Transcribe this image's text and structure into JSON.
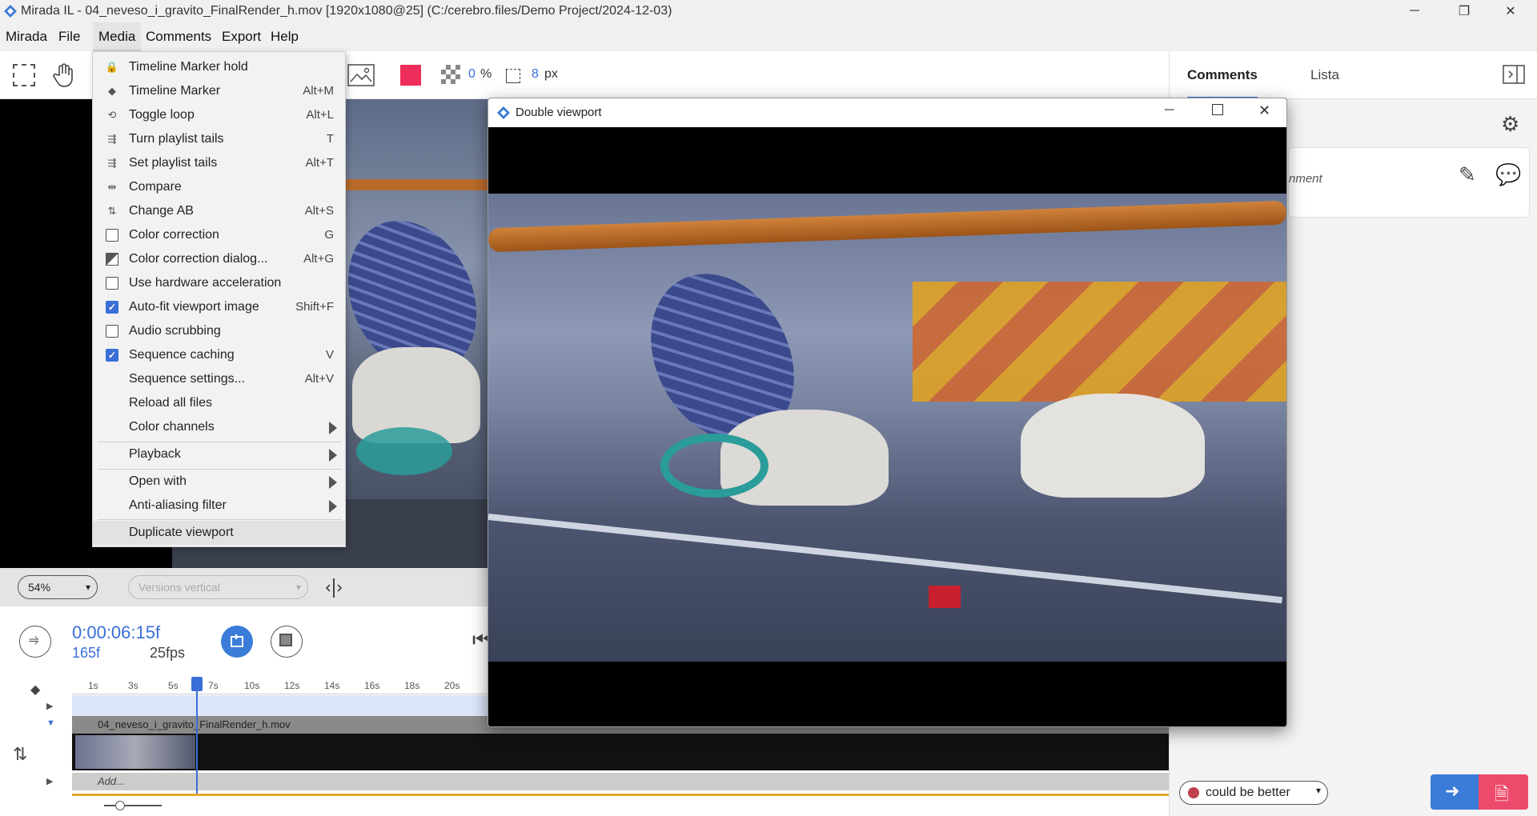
{
  "window": {
    "title": "Mirada IL - 04_neveso_i_gravito_FinalRender_h.mov [1920x1080@25] (C:/cerebro.files/Demo Project/2024-12-03)",
    "minimize": "─",
    "restore": "❐",
    "close": "✕"
  },
  "menubar": [
    "Mirada",
    "File",
    "Media",
    "Comments",
    "Export",
    "Help"
  ],
  "toolbar": {
    "opacity_value": "0",
    "opacity_unit": "%",
    "brush_size": "8",
    "brush_unit": "px",
    "color": "#ee2e5a"
  },
  "media_menu": {
    "items": [
      {
        "label": "Timeline Marker hold",
        "shortcut": "",
        "icon": "lock-icon"
      },
      {
        "label": "Timeline Marker",
        "shortcut": "Alt+M",
        "icon": "diamond-icon"
      },
      {
        "label": "Toggle loop",
        "shortcut": "Alt+L",
        "icon": "loop-icon"
      },
      {
        "label": "Turn playlist tails",
        "shortcut": "T",
        "icon": "tails-icon"
      },
      {
        "label": "Set playlist tails",
        "shortcut": "Alt+T",
        "icon": "tails-icon"
      },
      {
        "label": "Compare",
        "shortcut": "",
        "icon": "compare-icon"
      },
      {
        "label": "Change AB",
        "shortcut": "Alt+S",
        "icon": "swap-icon"
      },
      {
        "label": "Color correction",
        "shortcut": "G",
        "icon": "checkbox"
      },
      {
        "label": "Color correction dialog...",
        "shortcut": "Alt+G",
        "icon": "color-dialog-icon"
      },
      {
        "label": "Use hardware acceleration",
        "shortcut": "",
        "icon": "checkbox"
      },
      {
        "label": "Auto-fit viewport image",
        "shortcut": "Shift+F",
        "icon": "checkbox-checked"
      },
      {
        "label": "Audio scrubbing",
        "shortcut": "",
        "icon": "checkbox"
      },
      {
        "label": "Sequence caching",
        "shortcut": "V",
        "icon": "checkbox-checked"
      },
      {
        "label": "Sequence settings...",
        "shortcut": "Alt+V",
        "icon": ""
      },
      {
        "label": "Reload all files",
        "shortcut": "",
        "icon": ""
      },
      {
        "label": "Color channels",
        "shortcut": "",
        "icon": "submenu"
      },
      {
        "label": "Playback",
        "shortcut": "",
        "icon": "submenu"
      },
      {
        "label": "Open with",
        "shortcut": "",
        "icon": "submenu"
      },
      {
        "label": "Anti-aliasing filter",
        "shortcut": "",
        "icon": "submenu"
      },
      {
        "label": "Duplicate viewport",
        "shortcut": "",
        "icon": ""
      }
    ]
  },
  "viewbar": {
    "zoom": "54%",
    "versions": "Versions vertical"
  },
  "transport": {
    "timecode": "0:00:06:15f",
    "frame": "165f",
    "fps": "25fps"
  },
  "timeline": {
    "ticks": [
      "1s",
      "3s",
      "5s",
      "7s",
      "10s",
      "12s",
      "14s",
      "16s",
      "18s",
      "20s"
    ],
    "clip_name": "04_neveso_i_gravito_FinalRender_h.mov",
    "add_label": "Add..."
  },
  "double_viewport": {
    "title": "Double viewport"
  },
  "right_panel": {
    "tabs": [
      "Comments",
      "Lista"
    ],
    "comment_placeholder": "nment",
    "status": "could be better"
  }
}
